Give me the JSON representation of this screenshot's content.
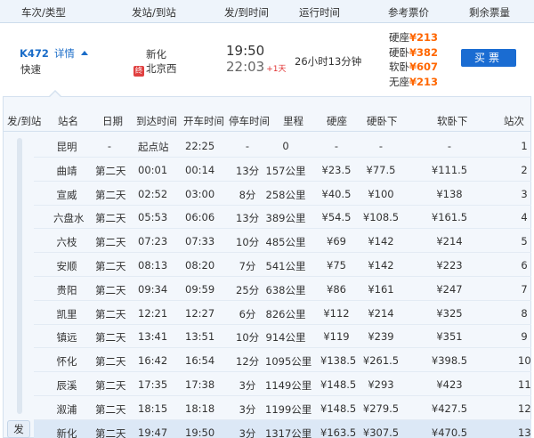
{
  "header": {
    "train_no": "车次/类型",
    "stations": "发站/到站",
    "times": "发/到时间",
    "duration": "运行时间",
    "price": "参考票价",
    "remaining": "剩余票量"
  },
  "train": {
    "number": "K472",
    "details_link": "详情",
    "type": "快速",
    "from_station": "新化",
    "to_badge": "终",
    "to_station": "北京西",
    "depart_time": "19:50",
    "arrive_time": "22:03",
    "day_offset": "+1天",
    "duration": "26小时13分钟",
    "prices": [
      {
        "seat": "硬座",
        "price": "¥213"
      },
      {
        "seat": "硬卧",
        "price": "¥382"
      },
      {
        "seat": "软卧",
        "price": "¥607"
      },
      {
        "seat": "无座",
        "price": "¥213"
      }
    ],
    "buy_label": "买票"
  },
  "detail_header": {
    "dep_arr": "发/到站",
    "station": "站名",
    "date": "日期",
    "arrival": "到达时间",
    "departure": "开车时间",
    "stop": "停车时间",
    "mileage": "里程",
    "hard_seat": "硬座",
    "hard_sleeper": "硬卧下",
    "soft_sleeper": "软卧下",
    "seq": "站次"
  },
  "badge": "发",
  "rows": [
    {
      "station": "昆明",
      "date": "-",
      "arr": "起点站",
      "dep": "22:25",
      "stop": "-",
      "km": "0",
      "hs": "-",
      "hsl": "-",
      "ssl": "-",
      "seq": "1"
    },
    {
      "station": "曲靖",
      "date": "第二天",
      "arr": "00:01",
      "dep": "00:14",
      "stop": "13分",
      "km": "157公里",
      "hs": "¥23.5",
      "hsl": "¥77.5",
      "ssl": "¥111.5",
      "seq": "2"
    },
    {
      "station": "宣威",
      "date": "第二天",
      "arr": "02:52",
      "dep": "03:00",
      "stop": "8分",
      "km": "258公里",
      "hs": "¥40.5",
      "hsl": "¥100",
      "ssl": "¥138",
      "seq": "3"
    },
    {
      "station": "六盘水",
      "date": "第二天",
      "arr": "05:53",
      "dep": "06:06",
      "stop": "13分",
      "km": "389公里",
      "hs": "¥54.5",
      "hsl": "¥108.5",
      "ssl": "¥161.5",
      "seq": "4"
    },
    {
      "station": "六枝",
      "date": "第二天",
      "arr": "07:23",
      "dep": "07:33",
      "stop": "10分",
      "km": "485公里",
      "hs": "¥69",
      "hsl": "¥142",
      "ssl": "¥214",
      "seq": "5"
    },
    {
      "station": "安顺",
      "date": "第二天",
      "arr": "08:13",
      "dep": "08:20",
      "stop": "7分",
      "km": "541公里",
      "hs": "¥75",
      "hsl": "¥142",
      "ssl": "¥223",
      "seq": "6"
    },
    {
      "station": "贵阳",
      "date": "第二天",
      "arr": "09:34",
      "dep": "09:59",
      "stop": "25分",
      "km": "638公里",
      "hs": "¥86",
      "hsl": "¥161",
      "ssl": "¥247",
      "seq": "7"
    },
    {
      "station": "凯里",
      "date": "第二天",
      "arr": "12:21",
      "dep": "12:27",
      "stop": "6分",
      "km": "826公里",
      "hs": "¥112",
      "hsl": "¥214",
      "ssl": "¥325",
      "seq": "8"
    },
    {
      "station": "镇远",
      "date": "第二天",
      "arr": "13:41",
      "dep": "13:51",
      "stop": "10分",
      "km": "914公里",
      "hs": "¥119",
      "hsl": "¥239",
      "ssl": "¥351",
      "seq": "9"
    },
    {
      "station": "怀化",
      "date": "第二天",
      "arr": "16:42",
      "dep": "16:54",
      "stop": "12分",
      "km": "1095公里",
      "hs": "¥138.5",
      "hsl": "¥261.5",
      "ssl": "¥398.5",
      "seq": "10"
    },
    {
      "station": "辰溪",
      "date": "第二天",
      "arr": "17:35",
      "dep": "17:38",
      "stop": "3分",
      "km": "1149公里",
      "hs": "¥148.5",
      "hsl": "¥293",
      "ssl": "¥423",
      "seq": "11"
    },
    {
      "station": "溆浦",
      "date": "第二天",
      "arr": "18:15",
      "dep": "18:18",
      "stop": "3分",
      "km": "1199公里",
      "hs": "¥148.5",
      "hsl": "¥279.5",
      "ssl": "¥427.5",
      "seq": "12"
    },
    {
      "station": "新化",
      "date": "第二天",
      "arr": "19:47",
      "dep": "19:50",
      "stop": "3分",
      "km": "1317公里",
      "hs": "¥163.5",
      "hsl": "¥307.5",
      "ssl": "¥470.5",
      "seq": "13"
    }
  ]
}
